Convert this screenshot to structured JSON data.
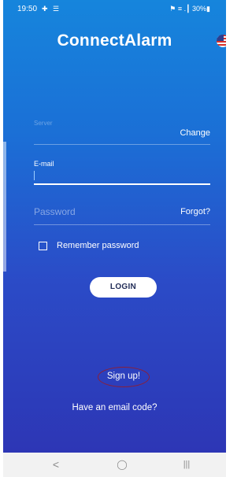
{
  "status_bar": {
    "time": "19:50",
    "left_icons": "✚ ☰",
    "right_text": "⚑ ≡ .┃ 30%▮"
  },
  "app": {
    "title": "ConnectAlarm",
    "language_flag": "us-flag-icon"
  },
  "form": {
    "server_label": "Server",
    "server_value": "",
    "change_label": "Change",
    "email_label": "E-mail",
    "email_value": "",
    "password_placeholder": "Password",
    "forgot_label": "Forgot?",
    "remember_label": "Remember password",
    "remember_checked": false,
    "login_label": "LOGIN"
  },
  "links": {
    "signup_label": "Sign up!",
    "email_code_label": "Have an email code?"
  },
  "nav_bar": {
    "back_icon": "<",
    "home_icon": "◯",
    "recents_icon": "|||"
  },
  "colors": {
    "gradient_top": "#1685dc",
    "gradient_bottom": "#2d36b5",
    "signup_circle": "#8a1f3a"
  }
}
